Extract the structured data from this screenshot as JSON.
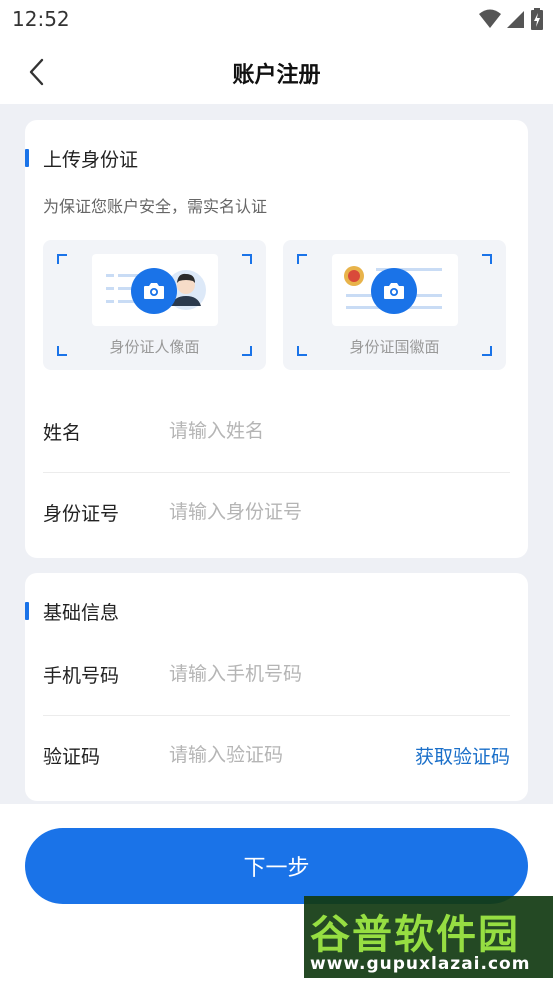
{
  "status_bar": {
    "time": "12:52"
  },
  "nav": {
    "title": "账户注册"
  },
  "id_section": {
    "title": "上传身份证",
    "subtitle": "为保证您账户安全，需实名认证",
    "front_caption": "身份证人像面",
    "back_caption": "身份证国徽面"
  },
  "form": {
    "name": {
      "label": "姓名",
      "placeholder": "请输入姓名"
    },
    "id_number": {
      "label": "身份证号",
      "placeholder": "请输入身份证号"
    }
  },
  "basic_section": {
    "title": "基础信息",
    "phone": {
      "label": "手机号码",
      "placeholder": "请输入手机号码"
    },
    "code": {
      "label": "验证码",
      "placeholder": "请输入验证码",
      "action": "获取验证码"
    }
  },
  "next_button": {
    "label": "下一步"
  },
  "watermark": {
    "title": "谷普软件园",
    "url": "www.gupuxlazai.com"
  },
  "colors": {
    "primary": "#1a73e8",
    "link": "#1a6fc9",
    "page_bg": "#eef0f5"
  }
}
